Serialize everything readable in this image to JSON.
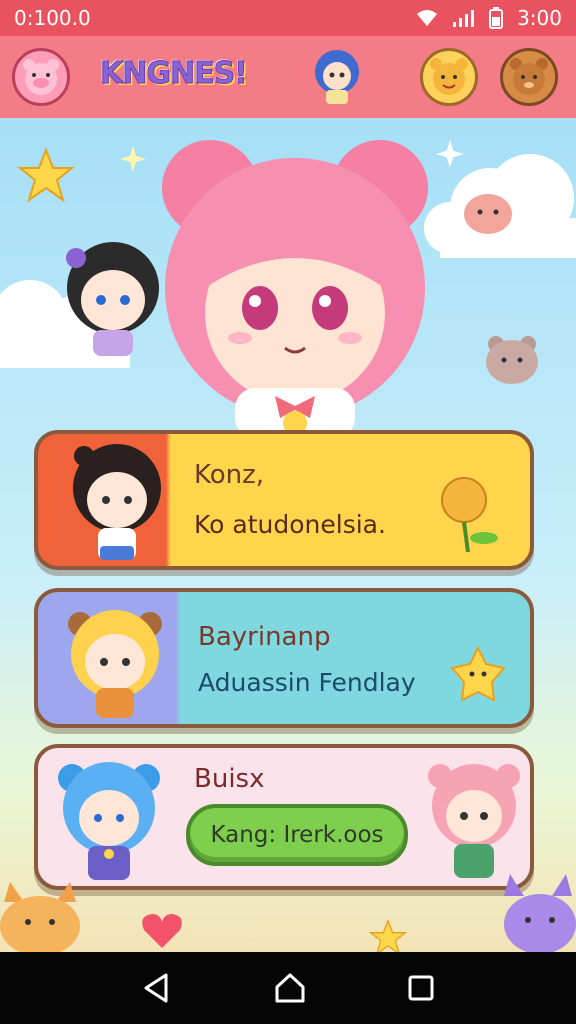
{
  "status_bar": {
    "left_text": "0:100.0",
    "time": "3:00"
  },
  "header": {
    "logo_text": "KNGNES!"
  },
  "cards": [
    {
      "title": "Konz,",
      "subtitle": "Ko atudonelsia."
    },
    {
      "title": "Bayrinanp",
      "subtitle": "Aduassin Fendlay"
    },
    {
      "title": "Buisx",
      "button_label": "Kang: Irerk.oos"
    }
  ],
  "colors": {
    "header": "#f47c86",
    "status": "#e9525f",
    "card1": "#ffd54b",
    "card2": "#7fd8e0",
    "card3": "#fbe3ec",
    "button": "#7fcf4e"
  },
  "icons": [
    "wifi-icon",
    "signal-icon",
    "battery-icon",
    "back-icon",
    "home-icon",
    "recents-icon"
  ]
}
